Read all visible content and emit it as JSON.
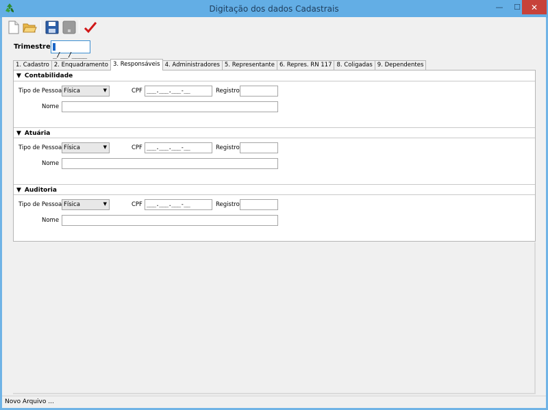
{
  "window": {
    "title": "Digitação dos dados Cadastrais",
    "minimize_glyph": "—",
    "maximize_glyph": "☐",
    "close_glyph": "✕"
  },
  "toolbar": {
    "buttons": [
      "new-file-icon",
      "open-folder-icon",
      "save-icon",
      "disabled-save-icon",
      "confirm-check-icon"
    ]
  },
  "trimestre": {
    "label": "Trimestre",
    "value": "_/__/____"
  },
  "tabs": [
    {
      "label": "1. Cadastro"
    },
    {
      "label": "2. Enquadramento"
    },
    {
      "label": "3. Responsáveis"
    },
    {
      "label": "4. Administradores"
    },
    {
      "label": "5. Representante"
    },
    {
      "label": "6. Repres. RN 117"
    },
    {
      "label": "8. Coligadas"
    },
    {
      "label": "9. Dependentes"
    }
  ],
  "active_tab_index": 2,
  "sections": [
    {
      "title": "Contabilidade",
      "tipo_pessoa_label": "Tipo de Pessoa",
      "tipo_pessoa_value": "Física",
      "cpf_label": "CPF",
      "cpf_value": "___.___.___-__",
      "registro_label": "Registro",
      "registro_value": "",
      "nome_label": "Nome",
      "nome_value": ""
    },
    {
      "title": "Atuária",
      "tipo_pessoa_label": "Tipo de Pessoa",
      "tipo_pessoa_value": "Física",
      "cpf_label": "CPF",
      "cpf_value": "___.___.___-__",
      "registro_label": "Registro",
      "registro_value": "",
      "nome_label": "Nome",
      "nome_value": ""
    },
    {
      "title": "Auditoria",
      "tipo_pessoa_label": "Tipo de Pessoa",
      "tipo_pessoa_value": "Física",
      "cpf_label": "CPF",
      "cpf_value": "___.___.___-__",
      "registro_label": "Registro",
      "registro_value": "",
      "nome_label": "Nome",
      "nome_value": ""
    }
  ],
  "status": {
    "text": "Novo Arquivo ..."
  },
  "colors": {
    "title_bar": "#63aee5",
    "close_button": "#c7423a",
    "focus_border": "#3b8dd0",
    "check_mark": "#d01818"
  }
}
